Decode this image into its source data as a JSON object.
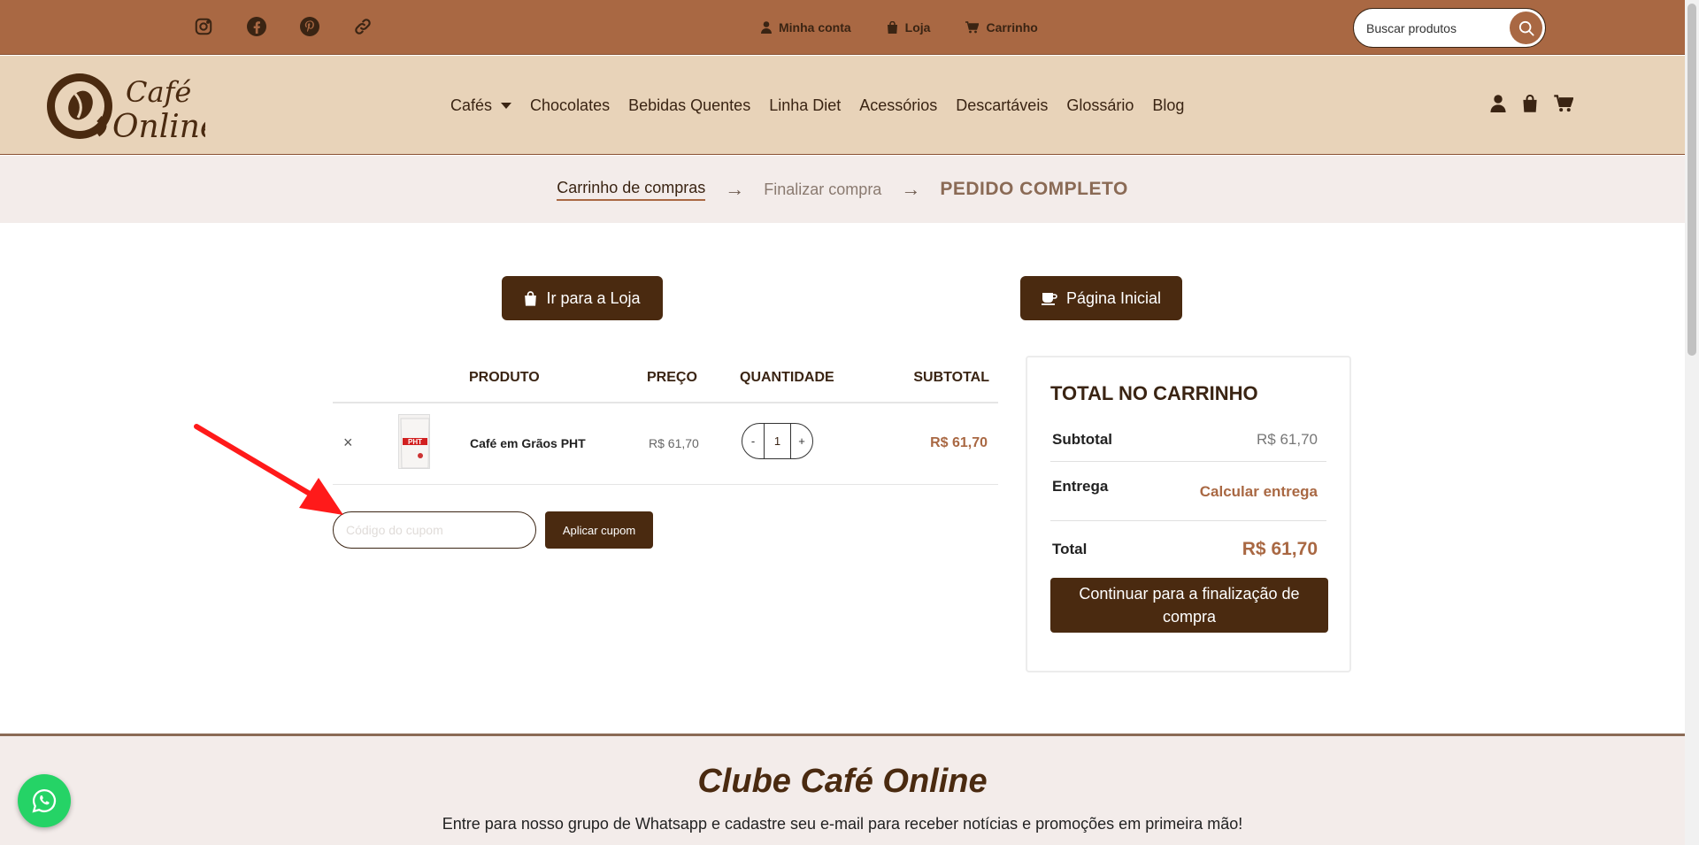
{
  "topbar": {
    "social": [
      {
        "icon": "instagram-icon"
      },
      {
        "icon": "facebook-icon"
      },
      {
        "icon": "pinterest-icon"
      },
      {
        "icon": "link-icon"
      }
    ],
    "nav": [
      {
        "label": "Minha conta",
        "icon": "user-icon"
      },
      {
        "label": "Loja",
        "icon": "shopping-bag-icon"
      },
      {
        "label": "Carrinho",
        "icon": "cart-icon"
      }
    ],
    "search": {
      "placeholder": "Buscar produtos"
    }
  },
  "header": {
    "logo": {
      "line1": "Café",
      "line2": "Online"
    },
    "nav": [
      {
        "label": "Cafés",
        "dropdown": true
      },
      {
        "label": "Chocolates"
      },
      {
        "label": "Bebidas Quentes"
      },
      {
        "label": "Linha Diet"
      },
      {
        "label": "Acessórios"
      },
      {
        "label": "Descartáveis"
      },
      {
        "label": "Glossário"
      },
      {
        "label": "Blog"
      }
    ]
  },
  "steps": {
    "step1": "Carrinho de compras",
    "arrow": "→",
    "step2": "Finalizar compra",
    "step3": "PEDIDO COMPLETO"
  },
  "actions": {
    "shop_label": "Ir para a Loja",
    "home_label": "Página Inicial"
  },
  "cart": {
    "headers": {
      "product": "PRODUTO",
      "price": "PREÇO",
      "qty": "QUANTIDADE",
      "subtotal": "SUBTOTAL"
    },
    "items": [
      {
        "remove": "×",
        "name": "Café em Grãos PHT",
        "price": "R$ 61,70",
        "qty": "1",
        "minus": "-",
        "plus": "+",
        "subtotal": "R$ 61,70",
        "thumb_text": "PHT"
      }
    ],
    "coupon": {
      "placeholder": "Código do cupom",
      "button": "Aplicar cupom"
    }
  },
  "totals": {
    "title": "TOTAL NO CARRINHO",
    "subtotal_label": "Subtotal",
    "subtotal_value": "R$ 61,70",
    "shipping_label": "Entrega",
    "shipping_value": "Calcular entrega",
    "total_label": "Total",
    "total_value": "R$ 61,70",
    "checkout": "Continuar para a finalização de compra"
  },
  "club": {
    "title": "Clube Café Online",
    "text": "Entre para nosso grupo de Whatsapp e cadastre seu e-mail para receber notícias e promoções em primeira mão!"
  },
  "colors": {
    "topbar": "#a96843",
    "header": "#e8d3b9",
    "dark_brown": "#4a2a10",
    "accent": "#a96843",
    "whatsapp": "#25d366",
    "annotation": "#ff1a1a"
  }
}
